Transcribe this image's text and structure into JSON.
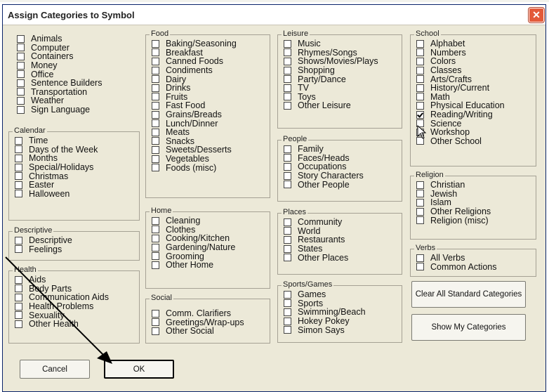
{
  "dialog": {
    "title": "Assign Categories to Symbol",
    "close_symbol": "✕"
  },
  "ungrouped": {
    "items": [
      {
        "label": "Animals",
        "checked": false
      },
      {
        "label": "Computer",
        "checked": false
      },
      {
        "label": "Containers",
        "checked": false
      },
      {
        "label": "Money",
        "checked": false
      },
      {
        "label": "Office",
        "checked": false
      },
      {
        "label": "Sentence Builders",
        "checked": false
      },
      {
        "label": "Transportation",
        "checked": false
      },
      {
        "label": "Weather",
        "checked": false
      },
      {
        "label": "Sign Language",
        "checked": false
      }
    ]
  },
  "groups": {
    "calendar": {
      "title": "Calendar",
      "items": [
        {
          "label": "Time",
          "checked": false
        },
        {
          "label": "Days of the Week",
          "checked": false
        },
        {
          "label": "Months",
          "checked": false
        },
        {
          "label": "Special/Holidays",
          "checked": false
        },
        {
          "label": "Christmas",
          "checked": false
        },
        {
          "label": "Easter",
          "checked": false
        },
        {
          "label": "Halloween",
          "checked": false
        }
      ]
    },
    "descriptive": {
      "title": "Descriptive",
      "items": [
        {
          "label": "Descriptive",
          "checked": false
        },
        {
          "label": "Feelings",
          "checked": false
        }
      ]
    },
    "health": {
      "title": "Health",
      "items": [
        {
          "label": "Aids",
          "checked": false
        },
        {
          "label": "Body Parts",
          "checked": false
        },
        {
          "label": "Communication Aids",
          "checked": false
        },
        {
          "label": "Health Problems",
          "checked": false
        },
        {
          "label": "Sexuality",
          "checked": false
        },
        {
          "label": "Other Health",
          "checked": false
        }
      ]
    },
    "food": {
      "title": "Food",
      "items": [
        {
          "label": "Baking/Seasoning",
          "checked": false
        },
        {
          "label": "Breakfast",
          "checked": false
        },
        {
          "label": "Canned Foods",
          "checked": false
        },
        {
          "label": "Condiments",
          "checked": false
        },
        {
          "label": "Dairy",
          "checked": false
        },
        {
          "label": "Drinks",
          "checked": false
        },
        {
          "label": "Fruits",
          "checked": false
        },
        {
          "label": "Fast Food",
          "checked": false
        },
        {
          "label": "Grains/Breads",
          "checked": false
        },
        {
          "label": "Lunch/Dinner",
          "checked": false
        },
        {
          "label": "Meats",
          "checked": false
        },
        {
          "label": "Snacks",
          "checked": false
        },
        {
          "label": "Sweets/Desserts",
          "checked": false
        },
        {
          "label": "Vegetables",
          "checked": false
        },
        {
          "label": "Foods (misc)",
          "checked": false
        }
      ]
    },
    "home": {
      "title": "Home",
      "items": [
        {
          "label": "Cleaning",
          "checked": false
        },
        {
          "label": "Clothes",
          "checked": false
        },
        {
          "label": "Cooking/Kitchen",
          "checked": false
        },
        {
          "label": "Gardening/Nature",
          "checked": false
        },
        {
          "label": "Grooming",
          "checked": false
        },
        {
          "label": "Other Home",
          "checked": false
        }
      ]
    },
    "social": {
      "title": "Social",
      "items": [
        {
          "label": "Comm. Clarifiers",
          "checked": false
        },
        {
          "label": "Greetings/Wrap-ups",
          "checked": false
        },
        {
          "label": "Other Social",
          "checked": false
        }
      ]
    },
    "leisure": {
      "title": "Leisure",
      "items": [
        {
          "label": "Music",
          "checked": false
        },
        {
          "label": "Rhymes/Songs",
          "checked": false
        },
        {
          "label": "Shows/Movies/Plays",
          "checked": false
        },
        {
          "label": "Shopping",
          "checked": false
        },
        {
          "label": "Party/Dance",
          "checked": false
        },
        {
          "label": "TV",
          "checked": false
        },
        {
          "label": "Toys",
          "checked": false
        },
        {
          "label": "Other Leisure",
          "checked": false
        }
      ]
    },
    "people": {
      "title": "People",
      "items": [
        {
          "label": "Family",
          "checked": false
        },
        {
          "label": "Faces/Heads",
          "checked": false
        },
        {
          "label": "Occupations",
          "checked": false
        },
        {
          "label": "Story Characters",
          "checked": false
        },
        {
          "label": "Other People",
          "checked": false
        }
      ]
    },
    "places": {
      "title": "Places",
      "items": [
        {
          "label": "Community",
          "checked": false
        },
        {
          "label": "World",
          "checked": false
        },
        {
          "label": "Restaurants",
          "checked": false
        },
        {
          "label": "States",
          "checked": false
        },
        {
          "label": "Other Places",
          "checked": false
        }
      ]
    },
    "sports": {
      "title": "Sports/Games",
      "items": [
        {
          "label": "Games",
          "checked": false
        },
        {
          "label": "Sports",
          "checked": false
        },
        {
          "label": "Swimming/Beach",
          "checked": false
        },
        {
          "label": "Hokey Pokey",
          "checked": false
        },
        {
          "label": "Simon Says",
          "checked": false
        }
      ]
    },
    "school": {
      "title": "School",
      "items": [
        {
          "label": "Alphabet",
          "checked": false
        },
        {
          "label": "Numbers",
          "checked": false
        },
        {
          "label": "Colors",
          "checked": false
        },
        {
          "label": "Classes",
          "checked": false
        },
        {
          "label": "Arts/Crafts",
          "checked": false
        },
        {
          "label": "History/Current",
          "checked": false
        },
        {
          "label": "Math",
          "checked": false
        },
        {
          "label": "Physical Education",
          "checked": false
        },
        {
          "label": "Reading/Writing",
          "checked": true
        },
        {
          "label": "Science",
          "checked": false
        },
        {
          "label": "Workshop",
          "checked": false
        },
        {
          "label": "Other School",
          "checked": false
        }
      ]
    },
    "religion": {
      "title": "Religion",
      "items": [
        {
          "label": "Christian",
          "checked": false
        },
        {
          "label": "Jewish",
          "checked": false
        },
        {
          "label": "Islam",
          "checked": false
        },
        {
          "label": "Other Religions",
          "checked": false
        },
        {
          "label": "Religion (misc)",
          "checked": false
        }
      ]
    },
    "verbs": {
      "title": "Verbs",
      "items": [
        {
          "label": "All Verbs",
          "checked": false
        },
        {
          "label": "Common Actions",
          "checked": false
        }
      ]
    }
  },
  "buttons": {
    "clear_all": "Clear All Standard Categories",
    "show_my": "Show My Categories",
    "cancel": "Cancel",
    "ok": "OK"
  },
  "colors": {
    "dialog_bg": "#ece9d8",
    "close_red": "#e35a3a",
    "group_border": "#a5a194"
  }
}
